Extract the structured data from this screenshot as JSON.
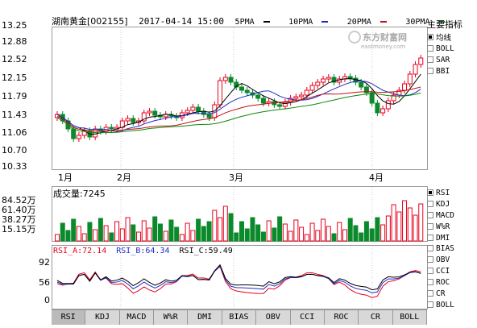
{
  "header": {
    "stock": "湖南黄金[002155]",
    "datetime": "2017-04-14 15:00",
    "ma": [
      {
        "label": "5PMA",
        "color": "#000000"
      },
      {
        "label": "10PMA",
        "color": "#1f2ec8"
      },
      {
        "label": "20PMA",
        "color": "#c01010"
      },
      {
        "label": "30PMA",
        "color": "#0a8a0a"
      }
    ]
  },
  "logo": {
    "name": "东方财富网",
    "sub": "eastmoney.com"
  },
  "price_axis": [
    "13.25",
    "12.88",
    "12.52",
    "12.15",
    "11.79",
    "11.43",
    "11.06",
    "10.70",
    "10.33"
  ],
  "months": [
    "1月",
    "2月",
    "3月",
    "4月"
  ],
  "volume": {
    "label": "成交量:7245",
    "ticks": [
      "84.52万",
      "61.40万",
      "38.27万",
      "15.15万"
    ]
  },
  "rsi": {
    "a": "RSI_A:72.14",
    "b": "RSI_B:64.34",
    "c": "RSI_C:59.49",
    "ticks": [
      "92",
      "56",
      "0"
    ]
  },
  "main_indicators": {
    "title": "主要指标",
    "items": [
      "均线",
      "BOLL",
      "SAR",
      "BBI"
    ],
    "selected": 0
  },
  "vol_indicators": {
    "items": [
      "RSI",
      "KDJ",
      "MACD",
      "W%R",
      "DMI"
    ],
    "selected": 0
  },
  "sub_indicators": {
    "items": [
      "BIAS",
      "OBV",
      "CCI",
      "ROC",
      "CR",
      "BOLL"
    ]
  },
  "tabs": [
    "RSI",
    "KDJ",
    "MACD",
    "W%R",
    "DMI",
    "BIAS",
    "OBV",
    "CCI",
    "ROC",
    "CR",
    "BOLL"
  ],
  "active_tab": 0,
  "colors": {
    "up": "#e8001c",
    "down": "#0a8a2a",
    "ma5": "#000000",
    "ma10": "#1f2ec8",
    "ma20": "#c01010",
    "ma30": "#0a8a0a",
    "rsiA": "#e8001c",
    "rsiB": "#1f2ec8",
    "rsiC": "#000000"
  }
}
